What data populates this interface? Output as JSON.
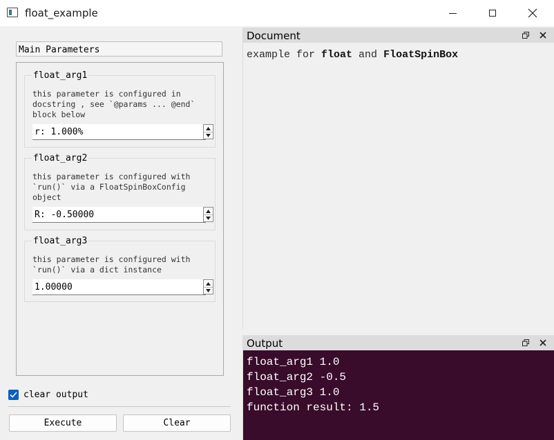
{
  "window": {
    "title": "float_example",
    "icon": "app-window-icon",
    "controls": [
      "minimize-icon",
      "maximize-icon",
      "close-icon"
    ]
  },
  "left_panel": {
    "group_header": "Main Parameters",
    "params": [
      {
        "name": "float_arg1",
        "description": "this parameter is configured in\ndocstring , see `@params ... @end`\nblock below",
        "value": "r: 1.000%"
      },
      {
        "name": "float_arg2",
        "description": "this parameter is configured with\n`run()` via a FloatSpinBoxConfig\nobject",
        "value": "R: -0.50000"
      },
      {
        "name": "float_arg3",
        "description": "this parameter is configured with\n`run()` via a dict instance",
        "value": "1.00000"
      }
    ],
    "clear_output": {
      "label": "clear output",
      "checked": true
    },
    "buttons": {
      "execute": "Execute",
      "clear": "Clear"
    }
  },
  "document": {
    "title": "Document",
    "text_prefix": "example for ",
    "text_bold1": "float",
    "text_mid": " and ",
    "text_bold2": "FloatSpinBox"
  },
  "output": {
    "title": "Output",
    "lines": [
      "float_arg1 1.0",
      "float_arg2 -0.5",
      "float_arg3 1.0",
      "function result: 1.5"
    ]
  },
  "colors": {
    "output_background": "#380c2a",
    "checkbox_accent": "#0a5fc4",
    "dock_title_background": "#dcdcdc"
  }
}
